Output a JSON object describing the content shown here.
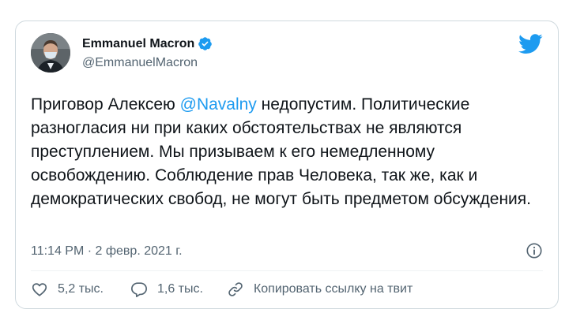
{
  "tweet": {
    "author": {
      "name": "Emmanuel Macron",
      "handle": "@EmmanuelMacron",
      "verified": true,
      "avatar_icon": "avatar"
    },
    "text_parts": {
      "before": "Приговор Алексею ",
      "mention": "@Navalny",
      "after": " недопустим. Политические разногласия ни при каких обстоятельствах не являются преступлением. Мы призываем к его немедленному освобождению. Соблюдение прав Человека, так же, как и демократических свобод, не могут быть предметом обсуждения."
    },
    "timestamp": "11:14 PM · 2 февр. 2021 г.",
    "actions": {
      "likes": "5,2 тыс.",
      "replies": "1,6 тыс.",
      "copy_link": "Копировать ссылку на твит"
    }
  },
  "colors": {
    "accent": "#1d9bf0",
    "text": "#0f1419",
    "secondary": "#536471",
    "border": "#cfd9de"
  },
  "icons": [
    "twitter-bird-icon",
    "verified-badge-icon",
    "info-icon",
    "heart-icon",
    "reply-icon",
    "link-icon"
  ]
}
